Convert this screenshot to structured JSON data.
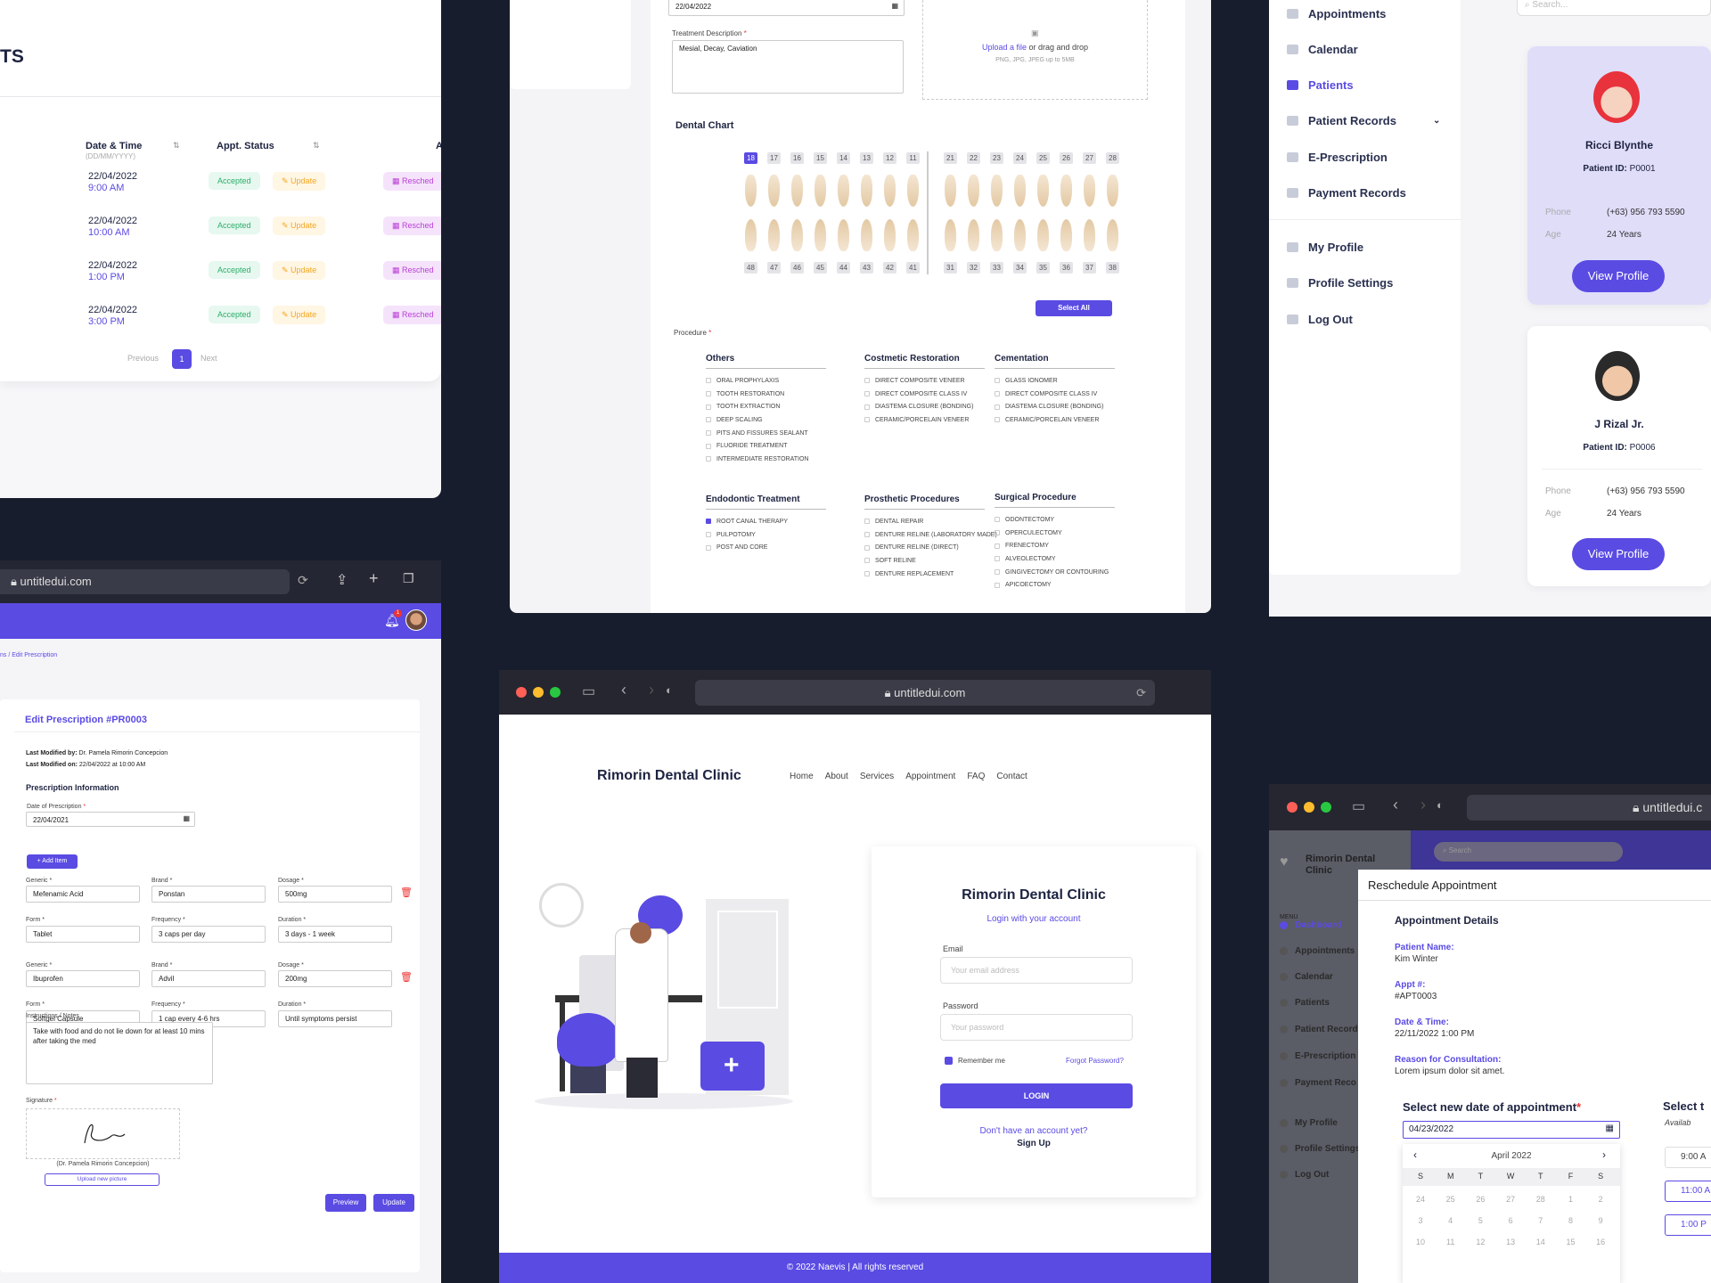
{
  "appointments": {
    "title_fragment": "TS",
    "col_datetime": "Date & Time",
    "col_datetime_hint": "(DD/MM/YYYY)",
    "col_status": "Appt. Status",
    "col_extra": "A",
    "rows": [
      {
        "date": "22/04/2022",
        "time": "9:00 AM",
        "status": "Accepted",
        "update": "Update",
        "resched": "Resched"
      },
      {
        "date": "22/04/2022",
        "time": "10:00 AM",
        "status": "Accepted",
        "update": "Update",
        "resched": "Resched"
      },
      {
        "date": "22/04/2022",
        "time": "1:00 PM",
        "status": "Accepted",
        "update": "Update",
        "resched": "Resched"
      },
      {
        "date": "22/04/2022",
        "time": "3:00 PM",
        "status": "Accepted",
        "update": "Update",
        "resched": "Resched"
      }
    ],
    "pagination": {
      "prev": "Previous",
      "page": "1",
      "next": "Next"
    }
  },
  "dental": {
    "date_value": "22/04/2022",
    "treatment_label": "Treatment Description",
    "treatment_value": "Mesial, Decay, Caviation",
    "upload_link": "Upload a file",
    "upload_rest": " or drag and drop",
    "upload_hint": "PNG, JPG, JPEG up to 5MB",
    "chart_title": "Dental Chart",
    "upper_numbers": [
      "18",
      "17",
      "16",
      "15",
      "14",
      "13",
      "12",
      "11",
      "21",
      "22",
      "23",
      "24",
      "25",
      "26",
      "27",
      "28"
    ],
    "lower_numbers": [
      "48",
      "47",
      "46",
      "45",
      "44",
      "43",
      "42",
      "41",
      "31",
      "32",
      "33",
      "34",
      "35",
      "36",
      "37",
      "38"
    ],
    "selected_tooth": "18",
    "select_all": "Select All",
    "procedure_label": "Procedure",
    "groups": [
      {
        "title": "Others",
        "items": [
          "ORAL PROPHYLAXIS",
          "TOOTH RESTORATION",
          "TOOTH EXTRACTION",
          "DEEP SCALING",
          "PITS AND FISSURES SEALANT",
          "FLUORIDE TREATMENT",
          "INTERMEDIATE RESTORATION"
        ]
      },
      {
        "title": "Costmetic Restoration",
        "items": [
          "DIRECT COMPOSITE VENEER",
          "DIRECT COMPOSITE CLASS IV",
          "DIASTEMA CLOSURE (BONDING)",
          "CERAMIC/PORCELAIN VENEER"
        ]
      },
      {
        "title": "Cementation",
        "items": [
          "GLASS IONOMER",
          "DIRECT COMPOSITE CLASS IV",
          "DIASTEMA CLOSURE (BONDING)",
          "CERAMIC/PORCELAIN VENEER"
        ]
      },
      {
        "title": "Endodontic Treatment",
        "items": [
          "ROOT CANAL THERAPY",
          "PULPOTOMY",
          "POST AND CORE"
        ],
        "checked": [
          0
        ]
      },
      {
        "title": "Prosthetic Procedures",
        "items": [
          "DENTAL REPAIR",
          "DENTURE RELINE (LABORATORY MADE)",
          "DENTURE RELINE (DIRECT)",
          "SOFT RELINE",
          "DENTURE REPLACEMENT"
        ]
      },
      {
        "title": "Surgical Procedure",
        "items": [
          "ODONTECTOMY",
          "OPERCULECTOMY",
          "FRENECTOMY",
          "ALVEOLECTOMY",
          "GINGIVECTOMY OR CONTOURING",
          "APICOECTOMY"
        ]
      }
    ]
  },
  "patients": {
    "search_placeholder": "Search...",
    "nav": [
      "Appointments",
      "Calendar",
      "Patients",
      "Patient Records",
      "E-Prescription",
      "Payment Records",
      "My Profile",
      "Profile Settings",
      "Log Out"
    ],
    "active_nav": "Patients",
    "cards": [
      {
        "name": "Ricci Blynthe",
        "id_label": "Patient ID:",
        "id": "P0001",
        "phone_label": "Phone",
        "phone": "(+63) 956 793 5590",
        "age_label": "Age",
        "age": "24 Years",
        "button": "View Profile"
      },
      {
        "name": "J Rizal Jr.",
        "id_label": "Patient ID:",
        "id": "P0006",
        "phone_label": "Phone",
        "phone": "(+63) 956 793 5590",
        "age_label": "Age",
        "age": "24 Years",
        "button": "View Profile"
      }
    ]
  },
  "prescription": {
    "url": "untitledui.com",
    "breadcrumb": "ns / Edit Prescription",
    "notif_count": "1",
    "title": "Edit Prescription #PR0003",
    "modified_by_label": "Last Modified by:",
    "modified_by": "Dr. Pamela Rimorin Concepcion",
    "modified_on_label": "Last Modified on:",
    "modified_on": "22/04/2022 at 10:00 AM",
    "section": "Prescription Information",
    "date_label": "Date of Prescription",
    "date_value": "22/04/2021",
    "add_item": "+  Add Item",
    "items": [
      {
        "generic": "Mefenamic Acid",
        "brand": "Ponstan",
        "dosage": "500mg",
        "form": "Tablet",
        "frequency": "3 caps per day",
        "duration": "3 days - 1 week"
      },
      {
        "generic": "Ibuprofen",
        "brand": "Advil",
        "dosage": "200mg",
        "form": "Softgel Capsule",
        "frequency": "1 cap every 4-6 hrs",
        "duration": "Until symptoms persist"
      }
    ],
    "labels": {
      "generic": "Generic",
      "brand": "Brand",
      "dosage": "Dosage",
      "form": "Form",
      "frequency": "Frequency",
      "duration": "Duration"
    },
    "notes_label": "Instructions / Notes",
    "notes": "Take with food and do not lie down for at least 10 mins after taking the med",
    "signature_label": "Signature",
    "signer": "(Dr. Pamela Rimorin Concepcion)",
    "upload_pic": "Upload new picture",
    "preview": "Preview",
    "update": "Update"
  },
  "login": {
    "url": "untitledui.com",
    "brand": "Rimorin Dental Clinic",
    "nav": [
      "Home",
      "About",
      "Services",
      "Appointment",
      "FAQ",
      "Contact"
    ],
    "card_title": "Rimorin Dental Clinic",
    "subtitle": "Login with your account",
    "email_label": "Email",
    "email_placeholder": "Your email address",
    "password_label": "Password",
    "password_placeholder": "Your password",
    "remember": "Remember me",
    "forgot": "Forgot Password?",
    "login_button": "LOGIN",
    "no_account": "Don't have an account yet?",
    "signup": "Sign Up",
    "footer": "© 2022 Naevis | All rights reserved"
  },
  "reschedule": {
    "url": "untitledui.c",
    "brand": "Rimorin Dental Clinic",
    "search_placeholder": "Search",
    "menu_label": "MENU",
    "nav": [
      "Dashboard",
      "Appointments",
      "Calendar",
      "Patients",
      "Patient Record",
      "E-Prescription",
      "Payment Reco",
      "My Profile",
      "Profile Settings",
      "Log Out"
    ],
    "modal_title": "Reschedule Appointment",
    "details_title": "Appointment Details",
    "fields": [
      {
        "label": "Patient Name:",
        "value": "Kim Winter"
      },
      {
        "label": "Appt #:",
        "value": "#APT0003"
      },
      {
        "label": "Date & Time:",
        "value": "22/11/2022 1:00 PM"
      },
      {
        "label": "Reason for Consultation:",
        "value": "Lorem ipsum dolor sit amet."
      }
    ],
    "new_date_label": "Select new date of appointment",
    "new_date_value": "04/23/2022",
    "select_time_fragment": "Select t",
    "available_fragment": "Availab",
    "times": [
      "9:00 A",
      "11:00 A",
      "1:00 P"
    ],
    "calendar": {
      "month": "April 2022",
      "days": [
        "S",
        "M",
        "T",
        "W",
        "T",
        "F",
        "S"
      ],
      "rows": [
        [
          "24",
          "25",
          "26",
          "27",
          "28",
          "1",
          "2"
        ],
        [
          "3",
          "4",
          "5",
          "6",
          "7",
          "8",
          "9"
        ],
        [
          "10",
          "11",
          "12",
          "13",
          "14",
          "15",
          "16"
        ]
      ]
    }
  },
  "colors": {
    "accent": "#5a4be3",
    "bg": "#171d2c",
    "green": "#2cae6a",
    "amber": "#f5a623",
    "magenta": "#b93fd6"
  }
}
